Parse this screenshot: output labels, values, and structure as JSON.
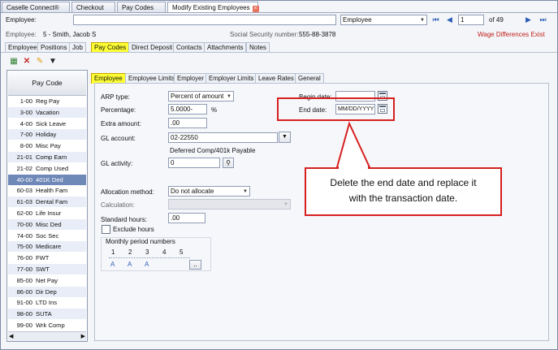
{
  "tabs": [
    "Caselle Connect®",
    "Checkout",
    "Pay Codes",
    "Modify Existing Employees"
  ],
  "toolbar": {
    "employee_label": "Employee:",
    "employee_value": "",
    "search_by": "Employee",
    "record_number": "1",
    "record_total": "of 49"
  },
  "employee_info": {
    "employee_label": "Employee:",
    "employee_name": "5 - Smith, Jacob S",
    "ssn_label": "Social Security number:",
    "ssn_value": "555-88-3878",
    "warning": "Wage Differences Exist"
  },
  "sub_tabs": [
    "Employee",
    "Positions",
    "Job",
    "Pay Codes",
    "Direct Deposit",
    "Contacts",
    "Attachments",
    "Notes"
  ],
  "pay_code_list": {
    "header": "Pay Code",
    "rows": [
      {
        "code": "1-00",
        "name": "Reg Pay"
      },
      {
        "code": "3-00",
        "name": "Vacation"
      },
      {
        "code": "4-00",
        "name": "Sick Leave"
      },
      {
        "code": "7-00",
        "name": "Holiday"
      },
      {
        "code": "8-00",
        "name": "Misc Pay"
      },
      {
        "code": "21-01",
        "name": "Comp Earn"
      },
      {
        "code": "21-02",
        "name": "Comp Used"
      },
      {
        "code": "40-00",
        "name": "401K Ded"
      },
      {
        "code": "60-03",
        "name": "Health Fam"
      },
      {
        "code": "61-03",
        "name": "Dental Fam"
      },
      {
        "code": "62-00",
        "name": "Life Insur"
      },
      {
        "code": "70-00",
        "name": "Misc Ded"
      },
      {
        "code": "74-00",
        "name": "Soc Sec"
      },
      {
        "code": "75-00",
        "name": "Medicare"
      },
      {
        "code": "76-00",
        "name": "FWT"
      },
      {
        "code": "77-00",
        "name": "SWT"
      },
      {
        "code": "85-00",
        "name": "Net Pay"
      },
      {
        "code": "86-00",
        "name": "Dir Dep"
      },
      {
        "code": "91-00",
        "name": "LTD Ins"
      },
      {
        "code": "98-00",
        "name": "SUTA"
      },
      {
        "code": "99-00",
        "name": "Wrk Comp"
      }
    ]
  },
  "inner_tabs": [
    "Employee",
    "Employee Limits",
    "Employer",
    "Employer Limits",
    "Leave Rates",
    "General"
  ],
  "form": {
    "arp_type_label": "ARP type:",
    "arp_type_value": "Percent of amount",
    "percentage_label": "Percentage:",
    "percentage_value": "5.0000-",
    "percent_sign": "%",
    "extra_amount_label": "Extra amount:",
    "extra_amount_value": ".00",
    "gl_account_label": "GL account:",
    "gl_account_value": "02-22550",
    "gl_account_desc": "Deferred Comp/401k Payable",
    "gl_activity_label": "GL activity:",
    "gl_activity_value": "0",
    "allocation_label": "Allocation method:",
    "allocation_value": "Do not allocate",
    "calculation_label": "Calculation:",
    "calculation_value": "",
    "standard_hours_label": "Standard hours:",
    "standard_hours_value": ".00",
    "exclude_hours_label": "Exclude hours",
    "monthly_label": "Monthly period numbers",
    "period_numbers": [
      "1",
      "2",
      "3",
      "4",
      "5"
    ],
    "period_values": [
      "A",
      "A",
      "A",
      "",
      ""
    ],
    "more_button": "..",
    "begin_date_label": "Begin date:",
    "begin_date_value": "",
    "end_date_label": "End date:",
    "end_date_value": "MM/DD/YYYY"
  },
  "callout": {
    "line1": "Delete the end date and replace it",
    "line2": "with the transaction date."
  },
  "colors": {
    "highlight": "#ffff33",
    "callout_border": "#d62020",
    "selected_row": "#6e88b8",
    "warning_text": "#c0201c"
  }
}
